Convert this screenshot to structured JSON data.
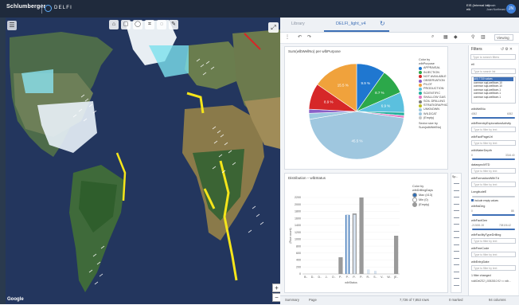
{
  "app": {
    "brand": "Schlumberger",
    "product": "DELFI",
    "user_line1": "EIS (Internal Int)",
    "user_line2": "eik",
    "user_line3": "domain",
    "user_line4": "Joan Northeast",
    "avatar_initials": "JN"
  },
  "map": {
    "tools": [
      "⌂",
      "▢",
      "◯",
      "⌗",
      "◌",
      "✎"
    ],
    "expand_icon": "⤢",
    "menu_icon": "☰",
    "zoom_in": "+",
    "zoom_out": "−",
    "attribution": "Google"
  },
  "tabs": {
    "library": "Library",
    "active": "DELFI_light_v4",
    "refresh_icon": "↻"
  },
  "toolbar": {
    "viewing": "Viewing"
  },
  "pie_card": {
    "title": "Sum(wlbWellNo) per wlbPurpose",
    "color_by_label": "Color by",
    "color_by_value": "wlbPurpose",
    "sector_note": "Sector size by Sum(wlbWellNo)",
    "legend": [
      {
        "label": "APPRAISAL",
        "color": "#1f77d0"
      },
      {
        "label": "INJECTION",
        "color": "#2ca84a"
      },
      {
        "label": "NOT AVAILABLE",
        "color": "#d62728"
      },
      {
        "label": "OBSERVATION",
        "color": "#8a5fc7"
      },
      {
        "label": "PILOT",
        "color": "#f0a23c"
      },
      {
        "label": "PRODUCTION",
        "color": "#5bc0de"
      },
      {
        "label": "SCIENTIFIC",
        "color": "#1fae9a"
      },
      {
        "label": "SHALLOW GAS",
        "color": "#e377c2"
      },
      {
        "label": "SOIL DRILLING",
        "color": "#7f7f7f"
      },
      {
        "label": "STRATIGRAPHIC",
        "color": "#bcbd22"
      },
      {
        "label": "UNKNOWN",
        "color": "#9ecae1"
      },
      {
        "label": "WILDCAT",
        "color": "#9fc7df"
      },
      {
        "label": "(Empty)",
        "color": "#c7c7c7"
      }
    ],
    "slices": [
      {
        "label": "APPRAISAL",
        "value": 9.9,
        "color": "#1f77d0",
        "text": "9.9 %"
      },
      {
        "label": "INJECTION",
        "value": 8.7,
        "color": "#2ca84a",
        "text": "8.7 %"
      },
      {
        "label": "PRODUCTION",
        "value": 6.9,
        "color": "#5bc0de",
        "text": "6.9 %"
      },
      {
        "label": "SCIENTIFIC",
        "value": 1.1,
        "color": "#1fae9a",
        "text": ""
      },
      {
        "label": "SHALLOW GAS",
        "value": 0.8,
        "color": "#e377c2",
        "text": ""
      },
      {
        "label": "WILDCAT",
        "value": 45.5,
        "color": "#9fc7df",
        "text": "45.5 %"
      },
      {
        "label": "UNKNOWN",
        "value": 2.0,
        "color": "#9ecae1",
        "text": ""
      },
      {
        "label": "OBSERVATION",
        "value": 1.4,
        "color": "#8a5fc7",
        "text": ""
      },
      {
        "label": "NOT AVAILABLE",
        "value": 8.9,
        "color": "#d62728",
        "text": "8.9 %"
      },
      {
        "label": "PILOT",
        "value": 15.5,
        "color": "#f0a23c",
        "text": "15.5 %"
      }
    ]
  },
  "bar_card": {
    "title": "Distribution – wlbStatus",
    "color_by_label": "Color by",
    "color_by_value": "wlbDrillingDays",
    "legend": [
      {
        "label": "Max (413)",
        "color": "#2f6db5"
      },
      {
        "label": "Min (0)",
        "color": "#ffffff"
      },
      {
        "label": "(Empty)",
        "color": "#9a9a9a"
      }
    ],
    "ylabel": "(Row count)",
    "xlabel": "wlbStatus",
    "yticks": [
      "0",
      "200",
      "400",
      "600",
      "800",
      "1000",
      "1200",
      "1400",
      "1600",
      "1800",
      "2000",
      "2200"
    ],
    "ymax": 2200
  },
  "mini_panel": {
    "title": "Sp..."
  },
  "chart_data": [
    {
      "type": "pie",
      "title": "Sum(wlbWellNo) per wlbPurpose",
      "legend_title": "wlbPurpose",
      "slices": [
        {
          "label": "APPRAISAL",
          "value": 9.9
        },
        {
          "label": "INJECTION",
          "value": 8.7
        },
        {
          "label": "PRODUCTION",
          "value": 6.9
        },
        {
          "label": "SCIENTIFIC",
          "value": 1.1
        },
        {
          "label": "SHALLOW GAS",
          "value": 0.8
        },
        {
          "label": "WILDCAT",
          "value": 45.5
        },
        {
          "label": "UNKNOWN",
          "value": 2.0
        },
        {
          "label": "OBSERVATION",
          "value": 1.4
        },
        {
          "label": "NOT AVAILABLE",
          "value": 8.9
        },
        {
          "label": "PILOT",
          "value": 15.5
        }
      ]
    },
    {
      "type": "bar",
      "title": "Distribution – wlbStatus",
      "xlabel": "wlbStatus",
      "ylabel": "(Row count)",
      "ylim": [
        0,
        2200
      ],
      "categories": [
        "B..",
        "D..",
        "D..",
        "J..",
        "O..",
        "P..",
        "P..",
        "P..",
        "P..",
        "R..",
        "S..",
        "V..",
        "W..",
        "(E.."
      ],
      "series": [
        {
          "name": "(Empty)",
          "values": [
            0,
            0,
            0,
            0,
            0,
            480,
            0,
            1740,
            2250,
            0,
            0,
            0,
            0,
            1100
          ]
        },
        {
          "name": "Max (413)",
          "values": [
            0,
            0,
            0,
            0,
            0,
            0,
            1700,
            0,
            0,
            0,
            0,
            0,
            0,
            0
          ]
        },
        {
          "name": "Min (0)",
          "values": [
            0,
            0,
            0,
            0,
            0,
            0,
            1700,
            1700,
            0,
            120,
            80,
            0,
            0,
            0
          ]
        }
      ]
    }
  ],
  "filters": {
    "title": "Filters",
    "search_placeholder": "Type to search filters",
    "section_first": "ell",
    "list_search": "Type to search list",
    "list_items": [
      "(All) 7730 values",
      "common sqd-wellbore-10",
      "common sqd-wellbore-10",
      "common sqd-wellbore-1",
      "common sqd-wellbore-1",
      "common sqd-wellbore-1"
    ],
    "well_no_label": "wlbWellNo",
    "well_no_min": "4052",
    "well_no_max": "6052",
    "f1_label": "wlbReentryExplorationActivity",
    "f2_label": "wlbFactPageUrl",
    "f3_label": "wlbWaterDepth",
    "f3_min": "0",
    "f3_max": "3316.40",
    "f4_label": "datasyncMTD",
    "f5_label": "wlbFormationWithTd",
    "f6_label": "LongitudeE",
    "include_empty": "Include empty values",
    "f7_label": "wlbNsDeg",
    "f7_min": "0",
    "f7_max": "88",
    "f8_label": "wlbFactGen",
    "f8_min": "-213081.00",
    "f8_max": "708106.42",
    "f9_label": "wlbFacilityTypeDrilling",
    "f10_label": "wlbFmeCode",
    "f11_label": "wlbEntryDate",
    "filter_changed": "1 filter changed",
    "input_placeholder": "Type to filter by text",
    "footer_text": "roldtDetZS2 (-5052810.92 <= wlb..."
  },
  "status": {
    "tab1": "Summary",
    "tab2": "Page",
    "rows": "7,726 of 7,853 rows",
    "marked": "0 marked",
    "columns": "94 columns"
  }
}
